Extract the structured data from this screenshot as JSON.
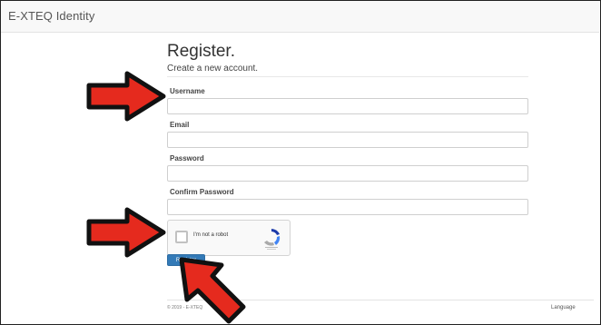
{
  "app": {
    "brand": "E-XTEQ Identity"
  },
  "form": {
    "title": "Register.",
    "subtitle": "Create a new account.",
    "fields": [
      {
        "label": "Username"
      },
      {
        "label": "Email"
      },
      {
        "label": "Password"
      },
      {
        "label": "Confirm Password"
      }
    ],
    "captcha_label": "I'm not a robot",
    "register_button": "Register"
  },
  "footer": {
    "text": "© 2019 - E-XTEQ",
    "language": "Language"
  },
  "colors": {
    "arrow_fill": "#e52a1e",
    "arrow_stroke": "#111111",
    "button": "#337ab7"
  }
}
